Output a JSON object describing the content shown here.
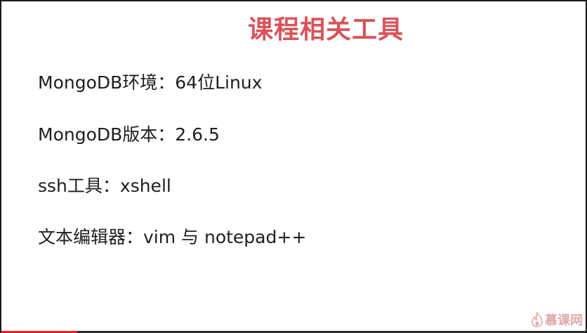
{
  "slide": {
    "title": "课程相关工具",
    "title_color": "#d9525a",
    "items": [
      "MongoDB环境：64位Linux",
      "MongoDB版本：2.6.5",
      "ssh工具：xshell",
      "文本编辑器：vim 与 notepad++"
    ]
  },
  "watermark": {
    "text": "慕课网",
    "icon": "flame-logo-icon"
  },
  "video_progress": {
    "fraction": 0.13,
    "color": "#e02424"
  }
}
